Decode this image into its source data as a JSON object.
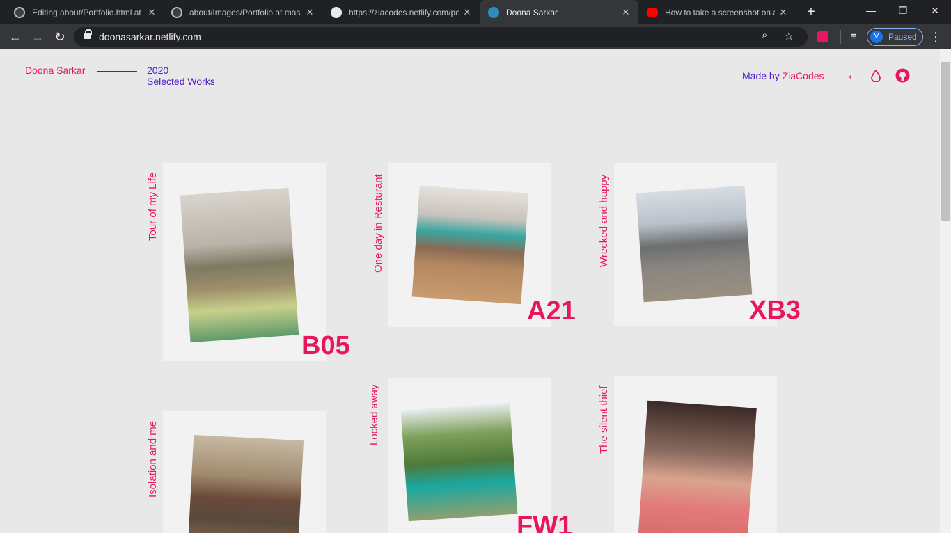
{
  "browser": {
    "tabs": [
      {
        "title": "Editing about/Portfolio.html at"
      },
      {
        "title": "about/Images/Portfolio at mas"
      },
      {
        "title": "https://ziacodes.netlify.com/po"
      },
      {
        "title": "Doona Sarkar"
      },
      {
        "title": "How to take a screenshot on a"
      }
    ],
    "url": "doonasarkar.netlify.com",
    "profile_initial": "V",
    "profile_status": "Paused"
  },
  "header": {
    "brand": "Doona Sarkar",
    "year": "2020",
    "subtitle": "Selected Works",
    "made_by_prefix": "Made by",
    "made_by_name": "ZiaCodes"
  },
  "works": [
    {
      "title": "Tour of my Life",
      "code": "B05"
    },
    {
      "title": "One day in Resturant",
      "code": "A21"
    },
    {
      "title": "Wrecked and happy",
      "code": "XB3"
    },
    {
      "title": "Isolation and me",
      "code": ""
    },
    {
      "title": "Locked away",
      "code": "FW1"
    },
    {
      "title": "The silent thief",
      "code": ""
    }
  ],
  "colors": {
    "accent": "#e8175d",
    "secondary": "#4b1bc7",
    "background": "#e8e8e8"
  }
}
